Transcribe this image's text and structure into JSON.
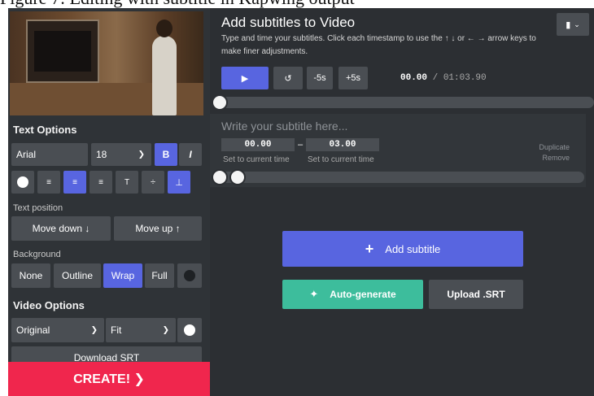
{
  "top_cut_text": "Figure 7: Editing with subtitle in Kapwing output",
  "left": {
    "text_options_title": "Text Options",
    "font_value": "Arial",
    "size_value": "18",
    "bold_label": "B",
    "italic_label": "I",
    "text_position_label": "Text position",
    "move_down_label": "Move down ↓",
    "move_up_label": "Move up ↑",
    "background_label": "Background",
    "background_options": [
      "None",
      "Outline",
      "Wrap",
      "Full"
    ],
    "video_options_title": "Video Options",
    "aspect_value": "Original",
    "fit_value": "Fit",
    "download_srt_label": "Download SRT",
    "create_label": "CREATE! ❯"
  },
  "right": {
    "title": "Add subtitles to Video",
    "subtitle": "Type and time your subtitles. Click each timestamp to use the ↑ ↓ or ← → arrow keys to make finer adjustments.",
    "play_icon": "▶",
    "replay_icon": "↺",
    "minus5_label": "-5s",
    "plus5_label": "+5s",
    "current_time": "00.00",
    "time_separator": " / ",
    "total_time": "01:03.90",
    "subtitle_placeholder": "Write your subtitle here...",
    "start_time": "00.00",
    "dash": "–",
    "end_time": "03.00",
    "set_start_label": "Set to current time",
    "set_end_label": "Set to current time",
    "duplicate_label": "Duplicate",
    "remove_label": "Remove",
    "add_subtitle_label": "Add subtitle",
    "auto_generate_label": "Auto-generate",
    "upload_srt_label": "Upload .SRT"
  },
  "colors": {
    "accent": "#5865e0",
    "create": "#f0264d",
    "auto_generate": "#3dbd9c",
    "panel_dark": "#2f3337",
    "control_bg": "#4a4e53"
  }
}
